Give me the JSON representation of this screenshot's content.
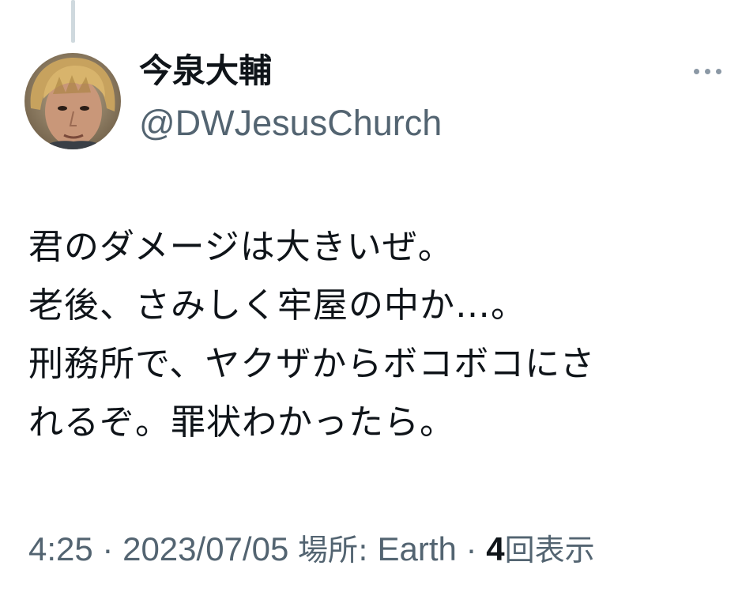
{
  "tweet": {
    "display_name": "今泉大輔",
    "handle": "@DWJesusChurch",
    "more_icon": "more-horizontal-icon",
    "body_lines": [
      "君のダメージは大きいぜ。",
      "老後、さみしく牢屋の中か…。",
      "刑務所で、ヤクザからボコボコにさ",
      "れるぞ。罪状わかったら。"
    ],
    "time": "4:25",
    "separator": "·",
    "date": "2023/07/05",
    "location_label": "場所:",
    "location": "Earth",
    "views_count": "4",
    "views_label": "回表示"
  },
  "colors": {
    "text_primary": "#0f1419",
    "text_secondary": "#536471",
    "thread_line": "#cfd9de",
    "background": "#ffffff"
  }
}
